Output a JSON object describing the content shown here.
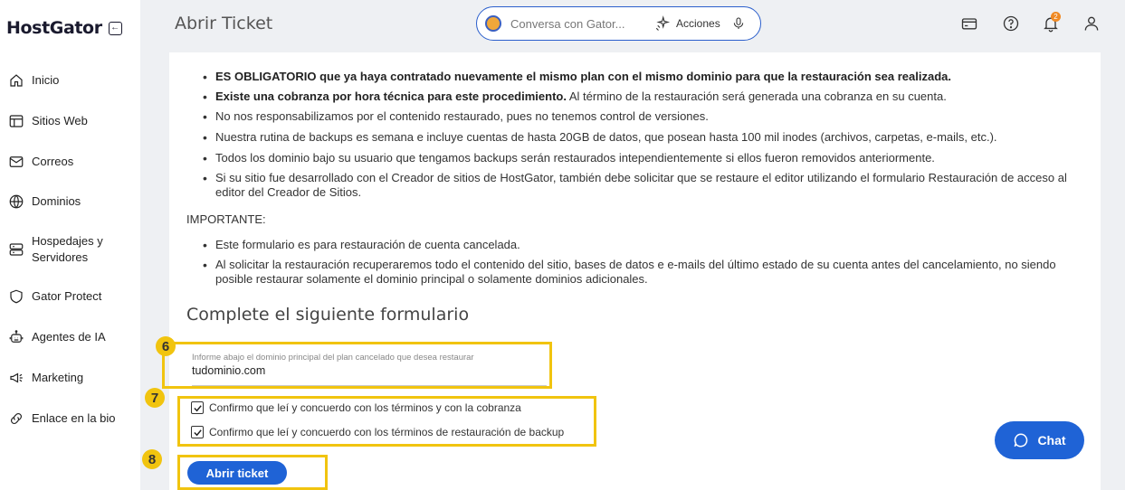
{
  "sidebar": {
    "logo": "HostGator",
    "items": [
      {
        "label": "Inicio",
        "icon": "home-icon"
      },
      {
        "label": "Sitios Web",
        "icon": "browser-icon"
      },
      {
        "label": "Correos",
        "icon": "mail-icon"
      },
      {
        "label": "Dominios",
        "icon": "globe-icon"
      },
      {
        "label": "Hospedajes y Servidores",
        "line1": "Hospedajes y",
        "line2": "Servidores",
        "icon": "server-icon"
      },
      {
        "label": "Gator Protect",
        "icon": "shield-icon"
      },
      {
        "label": "Agentes de IA",
        "icon": "robot-icon"
      },
      {
        "label": "Marketing",
        "icon": "megaphone-icon"
      },
      {
        "label": "Enlace en la bio",
        "icon": "link-icon"
      }
    ]
  },
  "header": {
    "title": "Abrir Ticket",
    "search_placeholder": "Conversa con Gator...",
    "actions_label": "Acciones",
    "notification_count": "2"
  },
  "content": {
    "bullets1": [
      {
        "bold": "ES OBLIGATORIO que ya haya contratado nuevamente el mismo plan con el mismo dominio para que la restauración sea realizada.",
        "rest": ""
      },
      {
        "bold": "Existe una cobranza por hora técnica para este procedimiento.",
        "rest": " Al término de la restauración será generada una cobranza en su cuenta."
      },
      {
        "bold": "",
        "rest": "No nos responsabilizamos por el contenido restaurado, pues no tenemos control de versiones."
      },
      {
        "bold": "",
        "rest": "Nuestra rutina de backups es semana e incluye cuentas de hasta 20GB de datos, que posean hasta 100 mil inodes (archivos, carpetas, e-mails, etc.)."
      },
      {
        "bold": "",
        "rest": "Todos los dominio bajo su usuario que tengamos backups serán restaurados intependientemente si ellos fueron removidos anteriormente."
      },
      {
        "bold": "",
        "rest": "Si su sitio fue desarrollado con el Creador de sitios de HostGator, también debe solicitar que se restaure el editor utilizando el formulario Restauración de acceso al editor del Creador de Sitios."
      }
    ],
    "important_label": "IMPORTANTE:",
    "bullets2": [
      "Este formulario es para restauración de cuenta cancelada.",
      "Al solicitar la restauración recuperaremos todo el contenido del sitio, bases de datos e e-mails del último estado de su cuenta antes del cancelamiento, no siendo posible restaurar solamente el dominio principal o solamente dominios adicionales."
    ],
    "form_title": "Complete el siguiente formulario",
    "domain_field": {
      "label": "Informe abajo el dominio principal del plan cancelado que desea restaurar",
      "value": "tudominio.com"
    },
    "checkboxes": [
      {
        "label": "Confirmo que leí y concuerdo con los términos y con la cobranza",
        "checked": true
      },
      {
        "label": "Confirmo que leí y concuerdo con los términos de restauración de backup",
        "checked": true
      }
    ],
    "submit_label": "Abrir ticket"
  },
  "annotations": {
    "step6": "6",
    "step7": "7",
    "step8": "8",
    "color": "#f1c40f"
  },
  "chat": {
    "label": "Chat"
  },
  "colors": {
    "accent": "#1f63d6",
    "highlight": "#f1c40f",
    "badge": "#f08a24"
  }
}
